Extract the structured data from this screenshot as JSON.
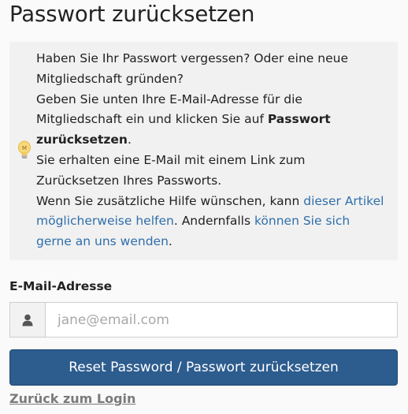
{
  "page": {
    "title": "Passwort zurücksetzen"
  },
  "info": {
    "line1": "Haben Sie Ihr Passwort vergessen? Oder eine neue",
    "line2": "Mitgliedschaft gründen?",
    "line3": "Geben Sie unten Ihre E-Mail-Adresse für die",
    "line4_pre": "Mitgliedschaft ein und klicken Sie auf ",
    "line4_bold": "Passwort",
    "line5_bold": "zurücksetzen",
    "line5_post": ".",
    "line6": "Sie erhalten eine E-Mail mit einem Link zum",
    "line7": "Zurücksetzen Ihres Passworts.",
    "line8_pre": "Wenn Sie zusätzliche Hilfe wünschen, kann ",
    "line8_link": "dieser Artikel",
    "line9_link": "möglicherweise helfen",
    "line9_mid": ". Andernfalls ",
    "line9_link2": "können Sie sich",
    "line10_link2": "gerne an uns wenden",
    "line10_post": ".",
    "icon": "lightbulb-icon",
    "bulb_letter": "M",
    "link_color": "#2f6fab"
  },
  "form": {
    "email_label": "E-Mail-Adresse",
    "email_icon": "user-icon",
    "email_value": "",
    "email_placeholder": "jane@email.com",
    "submit_label": "Reset Password / Passwort zurücksetzen",
    "button_color": "#2d5c8e",
    "back_link": "Zurück zum Login"
  }
}
